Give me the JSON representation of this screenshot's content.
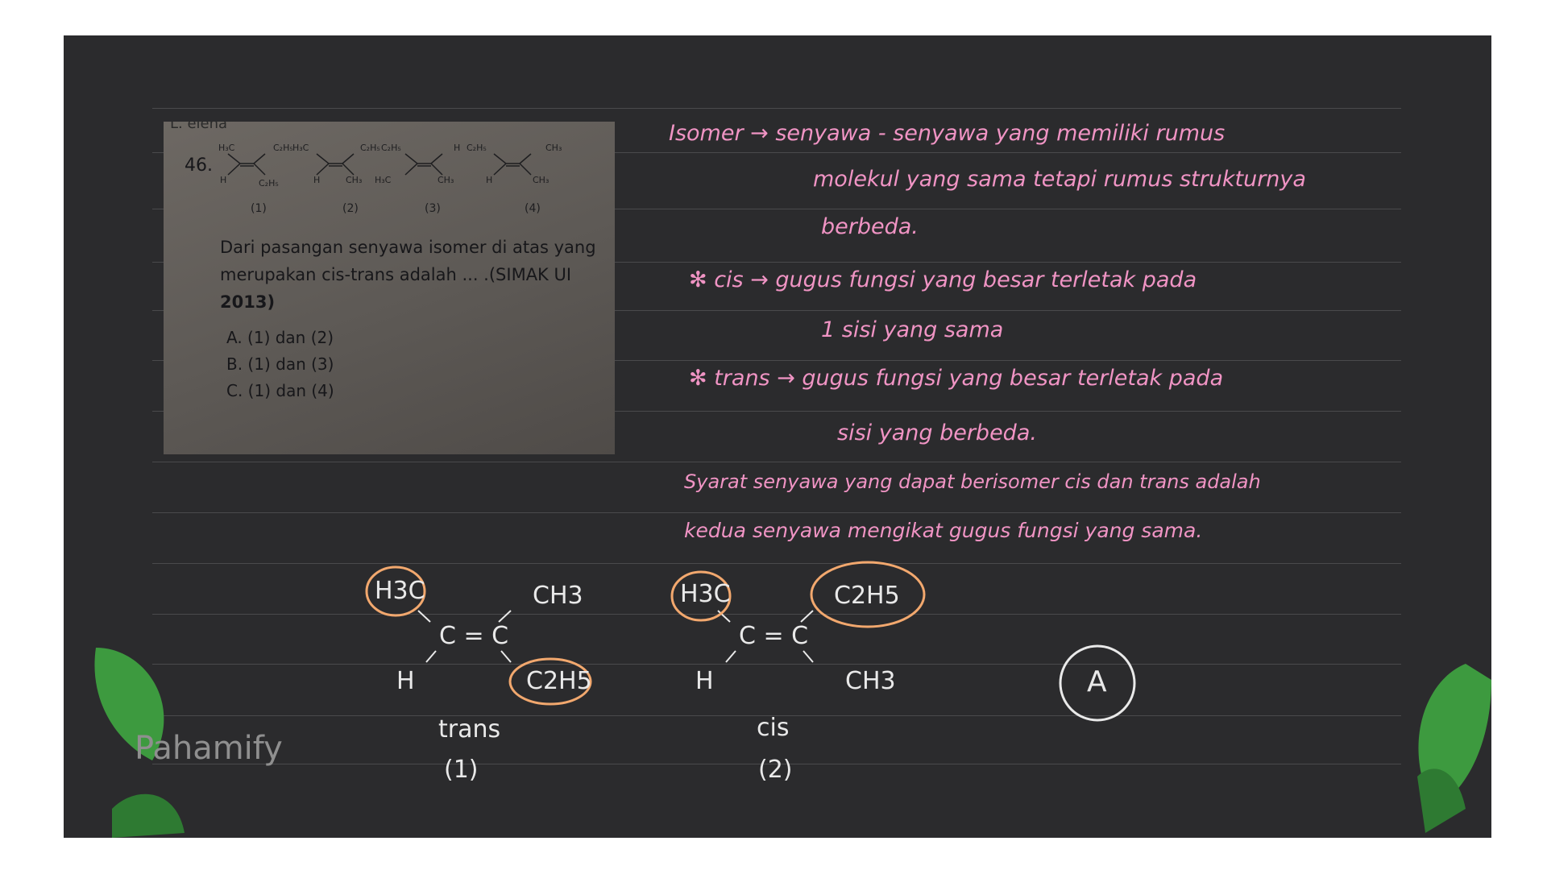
{
  "colors": {
    "board": "#2b2b2d",
    "pink_ink": "#f094c4",
    "white_ink": "#e9e9e9",
    "orange_circle": "#f2a86e",
    "leaf_green": "#3d9a3f"
  },
  "photo": {
    "question_number": "46.",
    "structure_labels": [
      "(1)",
      "(2)",
      "(3)",
      "(4)"
    ],
    "question_lines": [
      "Dari pasangan senyawa isomer di atas yang",
      "merupakan cis-trans adalah ... .(SIMAK UI",
      "2013)"
    ],
    "options": [
      "A.  (1) dan (2)",
      "B.  (1) dan (3)",
      "C.  (1) dan (4)"
    ]
  },
  "notes": {
    "line1": "Isomer → senyawa - senyawa yang memiliki rumus",
    "line2": "molekul yang sama tetapi rumus strukturnya",
    "line3": "berbeda.",
    "line4": "✻ cis → gugus fungsi yang besar terletak pada",
    "line5": "1 sisi yang sama",
    "line6": "✻ trans → gugus fungsi yang besar terletak pada",
    "line7": "sisi yang berbeda.",
    "line8": "Syarat senyawa yang dapat berisomer cis dan trans adalah",
    "line9": "kedua senyawa mengikat gugus fungsi yang sama."
  },
  "structures": {
    "trans": {
      "top_left": "H3C",
      "top_right": "CH3",
      "center": "C = C",
      "bottom_left": "H",
      "bottom_right": "C2H5",
      "name": "trans",
      "number": "(1)"
    },
    "cis": {
      "top_left": "H3C",
      "top_right": "C2H5",
      "center": "C = C",
      "bottom_left": "H",
      "bottom_right": "CH3",
      "name": "cis",
      "number": "(2)"
    }
  },
  "answer": "A",
  "brand": "Pahamify"
}
